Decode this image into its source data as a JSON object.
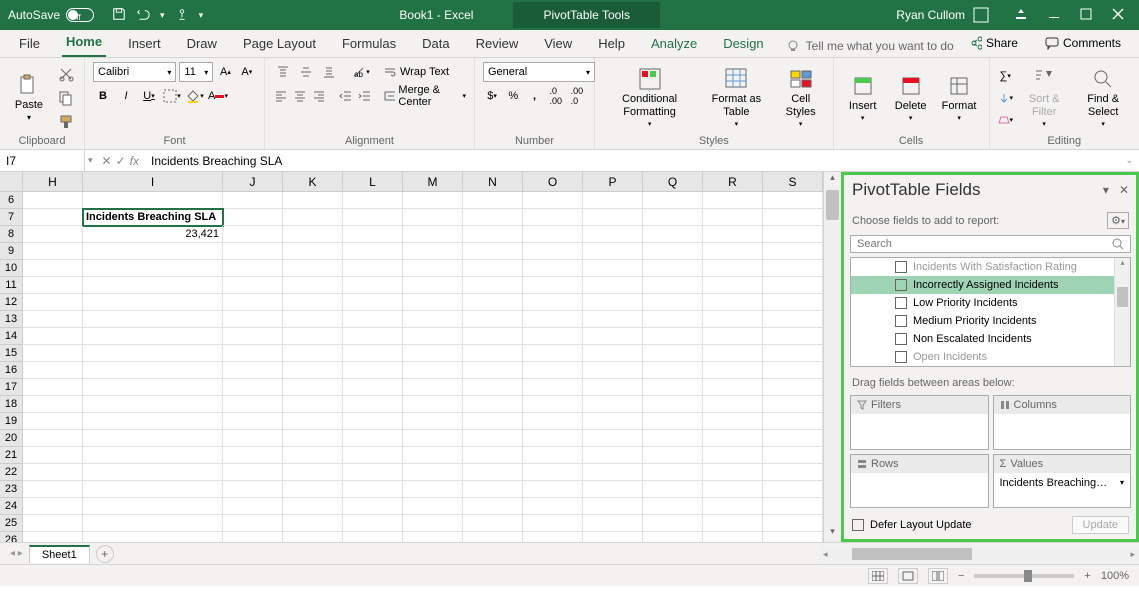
{
  "title_bar": {
    "autosave": "AutoSave",
    "autosave_state": "Off",
    "doc_title": "Book1 - Excel",
    "context_tab": "PivotTable Tools",
    "user": "Ryan Cullom"
  },
  "tabs": {
    "file": "File",
    "home": "Home",
    "insert": "Insert",
    "draw": "Draw",
    "page_layout": "Page Layout",
    "formulas": "Formulas",
    "data": "Data",
    "review": "Review",
    "view": "View",
    "help": "Help",
    "analyze": "Analyze",
    "design": "Design",
    "tell_me": "Tell me what you want to do",
    "share": "Share",
    "comments": "Comments"
  },
  "ribbon": {
    "clipboard": {
      "label": "Clipboard",
      "paste": "Paste"
    },
    "font": {
      "label": "Font",
      "name": "Calibri",
      "size": "11"
    },
    "alignment": {
      "label": "Alignment",
      "wrap": "Wrap Text",
      "merge": "Merge & Center"
    },
    "number": {
      "label": "Number",
      "format": "General"
    },
    "styles": {
      "label": "Styles",
      "cond": "Conditional Formatting",
      "fmt_table": "Format as Table",
      "cell": "Cell Styles"
    },
    "cells": {
      "label": "Cells",
      "insert": "Insert",
      "delete": "Delete",
      "format": "Format"
    },
    "editing": {
      "label": "Editing",
      "sort": "Sort & Filter",
      "find": "Find & Select"
    }
  },
  "formula_bar": {
    "name_box": "I7",
    "formula": "Incidents Breaching SLA"
  },
  "columns": [
    "H",
    "I",
    "J",
    "K",
    "L",
    "M",
    "N",
    "O",
    "P",
    "Q",
    "R",
    "S"
  ],
  "rows_start": 6,
  "rows_count": 22,
  "cells": {
    "I7": "Incidents Breaching SLA",
    "I8": "23,421"
  },
  "pane": {
    "title": "PivotTable Fields",
    "choose": "Choose fields to add to report:",
    "search_placeholder": "Search",
    "fields": [
      {
        "label": "Incidents With Satisfaction Rating",
        "cls": "cut"
      },
      {
        "label": "Incorrectly Assigned Incidents",
        "cls": "highlight"
      },
      {
        "label": "Low Priority Incidents",
        "cls": ""
      },
      {
        "label": "Medium Priority Incidents",
        "cls": ""
      },
      {
        "label": "Non Escalated Incidents",
        "cls": ""
      },
      {
        "label": "Open Incidents",
        "cls": "cut"
      }
    ],
    "drag": "Drag fields between areas below:",
    "filters": "Filters",
    "columns": "Columns",
    "rows": "Rows",
    "values": "Values",
    "value_item": "Incidents Breaching SLA",
    "defer": "Defer Layout Update",
    "update": "Update"
  },
  "sheet_tabs": {
    "sheet1": "Sheet1"
  },
  "status": {
    "zoom": "100%"
  }
}
